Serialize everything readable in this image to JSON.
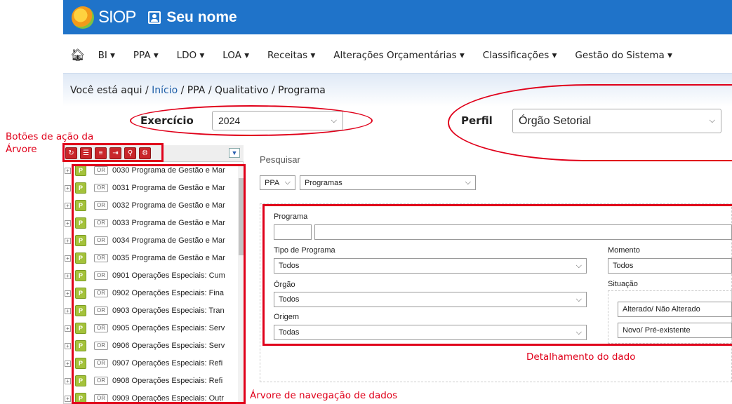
{
  "header": {
    "brand": "SIOP",
    "user": "Seu nome"
  },
  "menu": {
    "items": [
      "BI ▾",
      "PPA ▾",
      "LDO ▾",
      "LOA ▾",
      "Receitas ▾",
      "Alterações Orçamentárias ▾",
      "Classificações ▾",
      "Gestão do Sistema ▾"
    ]
  },
  "breadcrumb": {
    "prefix": "Você está aqui",
    "sep": "/",
    "home": "Início",
    "items": [
      "PPA",
      "Qualitativo",
      "Programa"
    ]
  },
  "filters": {
    "exercicio_label": "Exercício",
    "exercicio_value": "2024",
    "perfil_label": "Perfil",
    "perfil_value": "Órgão Setorial"
  },
  "annotations": {
    "tree_actions": "Botões de ação da",
    "tree_actions2": "Árvore",
    "tree_nav": "Árvore de navegação de dados",
    "detail": "Detalhamento do dado"
  },
  "tree": {
    "rows": [
      {
        "p": "P",
        "or": "OR",
        "label": "0030 Programa de Gestão e Mar"
      },
      {
        "p": "P",
        "or": "OR",
        "label": "0031 Programa de Gestão e Mar"
      },
      {
        "p": "P",
        "or": "OR",
        "label": "0032 Programa de Gestão e Mar"
      },
      {
        "p": "P",
        "or": "OR",
        "label": "0033 Programa de Gestão e Mar"
      },
      {
        "p": "P",
        "or": "OR",
        "label": "0034 Programa de Gestão e Mar"
      },
      {
        "p": "P",
        "or": "OR",
        "label": "0035 Programa de Gestão e Mar"
      },
      {
        "p": "P",
        "or": "OR",
        "label": "0901 Operações Especiais: Cum"
      },
      {
        "p": "P",
        "or": "OR",
        "label": "0902 Operações Especiais: Fina"
      },
      {
        "p": "P",
        "or": "OR",
        "label": "0903 Operações Especiais: Tran"
      },
      {
        "p": "P",
        "or": "OR",
        "label": "0905 Operações Especiais: Serv"
      },
      {
        "p": "P",
        "or": "OR",
        "label": "0906 Operações Especiais: Serv"
      },
      {
        "p": "P",
        "or": "OR",
        "label": "0907 Operações Especiais: Refi"
      },
      {
        "p": "P",
        "or": "OR",
        "label": "0908 Operações Especiais: Refi"
      },
      {
        "p": "P",
        "or": "OR",
        "label": "0909 Operações Especiais: Outr"
      }
    ]
  },
  "search": {
    "title": "Pesquisar",
    "scope": "PPA",
    "type": "Programas",
    "programa_label": "Programa",
    "tipo_label": "Tipo de Programa",
    "tipo_value": "Todos",
    "momento_label": "Momento",
    "momento_value": "Todos",
    "orgao_label": "Órgão",
    "orgao_value": "Todos",
    "situacao_label": "Situação",
    "situacao_value1": "Alterado/ Não Alterado",
    "situacao_value2": "Novo/ Pré-existente",
    "origem_label": "Origem",
    "origem_value": "Todas"
  },
  "colors": {
    "brand_blue": "#1f73c9",
    "annotation_red": "#e0001a"
  }
}
